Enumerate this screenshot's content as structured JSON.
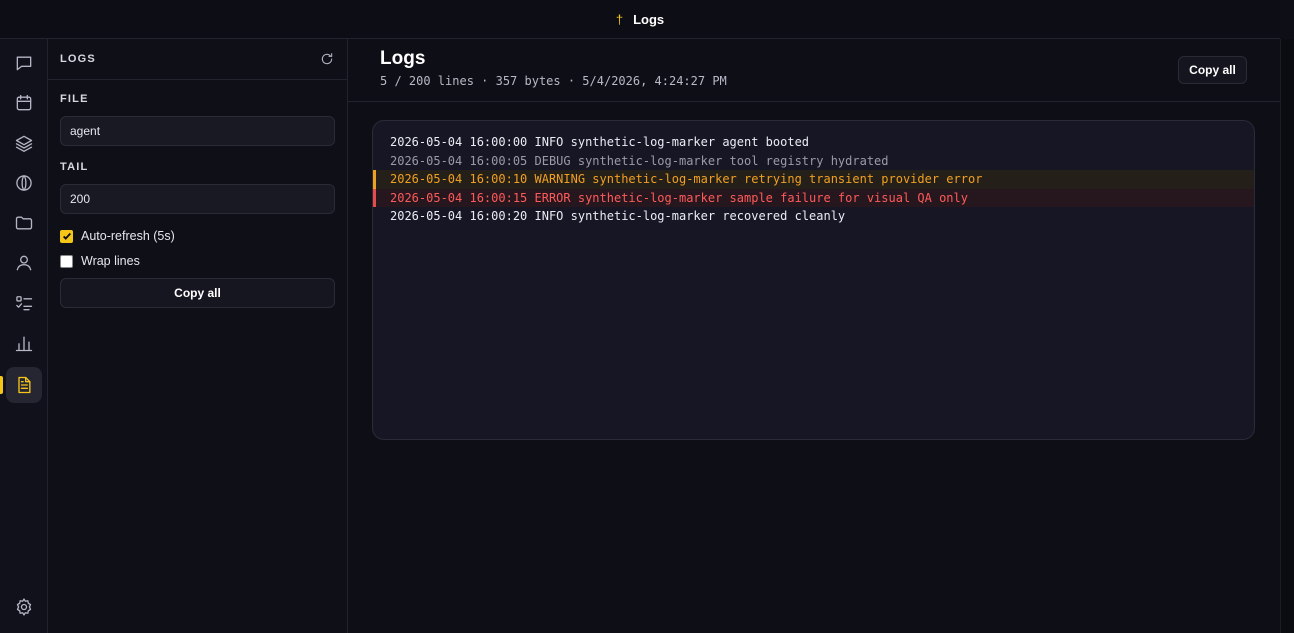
{
  "titlebar": {
    "glyph": "†",
    "title": "Logs"
  },
  "rail": {
    "items": [
      {
        "icon": "chat-icon"
      },
      {
        "icon": "calendar-icon"
      },
      {
        "icon": "layers-icon"
      },
      {
        "icon": "globe-icon"
      },
      {
        "icon": "folder-icon"
      },
      {
        "icon": "user-icon"
      },
      {
        "icon": "checklist-icon"
      },
      {
        "icon": "bar-chart-icon"
      },
      {
        "icon": "document-icon",
        "active": true
      }
    ],
    "bottom_icon": "settings-icon"
  },
  "panel": {
    "heading": "LOGS",
    "file_label": "FILE",
    "file_value": "agent",
    "tail_label": "TAIL",
    "tail_value": "200",
    "auto_refresh_label": "Auto-refresh (5s)",
    "auto_refresh_checked": true,
    "wrap_label": "Wrap lines",
    "wrap_checked": false,
    "copy_label": "Copy all"
  },
  "main": {
    "title": "Logs",
    "meta": "5 / 200 lines · 357 bytes · 5/4/2026, 4:24:27 PM",
    "copy_label": "Copy all",
    "lines": [
      {
        "level": "info",
        "text": "2026-05-04 16:00:00 INFO synthetic-log-marker agent booted"
      },
      {
        "level": "debug",
        "text": "2026-05-04 16:00:05 DEBUG synthetic-log-marker tool registry hydrated"
      },
      {
        "level": "warning",
        "text": "2026-05-04 16:00:10 WARNING synthetic-log-marker retrying transient provider error"
      },
      {
        "level": "error",
        "text": "2026-05-04 16:00:15 ERROR synthetic-log-marker sample failure for visual QA only"
      },
      {
        "level": "info",
        "text": "2026-05-04 16:00:20 INFO synthetic-log-marker recovered cleanly"
      }
    ]
  },
  "colors": {
    "accent": "#f5c518",
    "warning": "#f0a020",
    "error": "#ff5a5a",
    "background": "#0e0e17"
  }
}
